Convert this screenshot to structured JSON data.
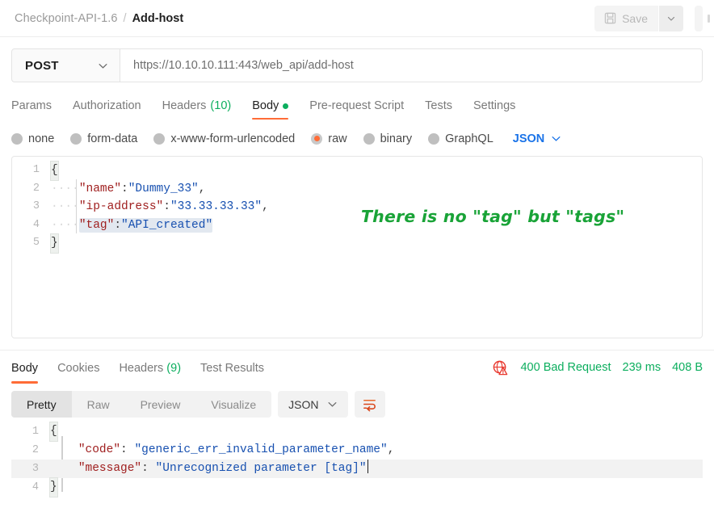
{
  "header": {
    "collection": "Checkpoint-API-1.6",
    "separator": "/",
    "request_name": "Add-host",
    "save_label": "Save",
    "save_icon": "floppy-disk-icon",
    "save_caret_icon": "chevron-down-icon"
  },
  "url_bar": {
    "method": "POST",
    "method_caret_icon": "chevron-down-icon",
    "url": "https://10.10.10.111:443/web_api/add-host"
  },
  "request_tabs": [
    {
      "label": "Params",
      "active": false
    },
    {
      "label": "Authorization",
      "active": false
    },
    {
      "label": "Headers",
      "count": "(10)",
      "active": false
    },
    {
      "label": "Body",
      "active": true,
      "dot": true
    },
    {
      "label": "Pre-request Script",
      "active": false
    },
    {
      "label": "Tests",
      "active": false
    },
    {
      "label": "Settings",
      "active": false
    }
  ],
  "body_types": [
    {
      "label": "none",
      "selected": false
    },
    {
      "label": "form-data",
      "selected": false
    },
    {
      "label": "x-www-form-urlencoded",
      "selected": false
    },
    {
      "label": "raw",
      "selected": true
    },
    {
      "label": "binary",
      "selected": false
    },
    {
      "label": "GraphQL",
      "selected": false
    }
  ],
  "body_format": {
    "label": "JSON",
    "caret_icon": "chevron-down-icon"
  },
  "request_body": {
    "lines": [
      {
        "num": "1",
        "indent": "",
        "text": "{",
        "type": "brace"
      },
      {
        "num": "2",
        "indent": "····",
        "key": "\"name\"",
        "colon": ":",
        "value": "\"Dummy_33\"",
        "tail": ","
      },
      {
        "num": "3",
        "indent": "····",
        "key": "\"ip-address\"",
        "colon": ":",
        "value": "\"33.33.33.33\"",
        "tail": ","
      },
      {
        "num": "4",
        "indent": "····",
        "key": "\"tag\"",
        "colon": ":",
        "value": "\"API_created\"",
        "tail": "",
        "highlighted": true
      },
      {
        "num": "5",
        "indent": "",
        "text": "}",
        "type": "brace"
      }
    ]
  },
  "annotation": {
    "text": "There is no \"tag\" but \"tags\"",
    "color": "#19a337"
  },
  "response_tabs": [
    {
      "label": "Body",
      "active": true
    },
    {
      "label": "Cookies",
      "active": false
    },
    {
      "label": "Headers",
      "count": "(9)",
      "active": false
    },
    {
      "label": "Test Results",
      "active": false
    }
  ],
  "response_status": {
    "icon": "globe-warning-icon",
    "status": "400 Bad Request",
    "time": "239 ms",
    "size": "408 B",
    "color": "#0cae5e"
  },
  "response_toolbar": {
    "views": [
      {
        "label": "Pretty",
        "active": true
      },
      {
        "label": "Raw",
        "active": false
      },
      {
        "label": "Preview",
        "active": false
      },
      {
        "label": "Visualize",
        "active": false
      }
    ],
    "format": "JSON",
    "format_caret_icon": "chevron-down-icon",
    "wrap_icon": "word-wrap-icon"
  },
  "response_body": {
    "lines": [
      {
        "num": "1",
        "indent": "",
        "text": "{",
        "type": "brace"
      },
      {
        "num": "2",
        "indent": "    ",
        "key": "\"code\"",
        "colon": ": ",
        "value": "\"generic_err_invalid_parameter_name\"",
        "tail": ","
      },
      {
        "num": "3",
        "indent": "    ",
        "key": "\"message\"",
        "colon": ": ",
        "value": "\"Unrecognized parameter [tag]\"",
        "tail": "",
        "highlighted": true,
        "cursor": true
      },
      {
        "num": "4",
        "indent": "",
        "text": "}",
        "type": "brace"
      }
    ]
  },
  "colors": {
    "accent": "#ff6c37",
    "json_key": "#a02020",
    "json_value": "#1750b0",
    "link_blue": "#1a73e8",
    "green": "#0cae5e",
    "error_red": "#e8392f"
  }
}
